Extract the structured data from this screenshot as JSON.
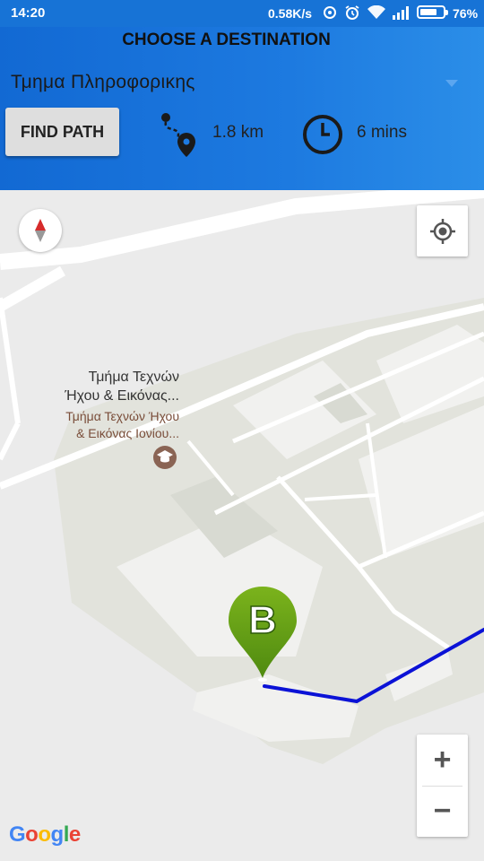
{
  "status": {
    "time": "14:20",
    "speed": "0.58K/s",
    "battery": "76%",
    "battery_level": 0.76
  },
  "header": {
    "title": "CHOOSE A DESTINATION",
    "destination": "Τμημα Πληροφορικης",
    "find_button": "FIND PATH",
    "distance": "1.8 km",
    "duration": "6 mins"
  },
  "map": {
    "poi_name_1": "Τμήμα Τεχνών",
    "poi_name_2": "Ήχου & Εικόνας...",
    "poi_name_3": "Τμήμα Τεχνών Ήχου",
    "poi_name_4": "& Εικόνας Ιονίου...",
    "marker_letter": "B",
    "zoom_in": "+",
    "zoom_out": "−",
    "route_color": "#0b12d6",
    "marker_color": "#7bb31c"
  },
  "icons": [
    "route-distance-icon",
    "clock-icon",
    "compass-icon",
    "my-location-icon",
    "education-icon",
    "destination-marker-icon"
  ],
  "attribution": "Google"
}
